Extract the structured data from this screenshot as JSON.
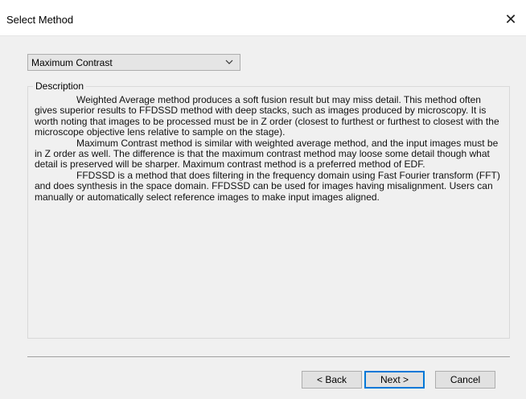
{
  "window": {
    "title": "Select Method",
    "close_glyph": "✕"
  },
  "method_select": {
    "selected": "Maximum Contrast"
  },
  "description": {
    "legend": "Description",
    "paragraphs": [
      "Weighted Average method produces a soft fusion result but may miss detail. This method often gives superior results to FFDSSD method with deep stacks, such as images produced by microscopy. It is worth noting that images to be processed must be in Z order (closest to furthest or furthest to closest with the microscope objective lens relative to sample on the stage).",
      "Maximum Contrast method is similar with weighted average method, and the input images must be in Z order as well. The difference is that the maximum contrast method may loose some detail though what detail is preserved will be sharper. Maximum contrast method is a preferred method of EDF.",
      "FFDSSD is a method that does filtering in the frequency domain using Fast Fourier transform (FFT) and does synthesis in the space domain. FFDSSD can be used for images having misalignment. Users can manually or automatically select reference images to make input images aligned."
    ]
  },
  "buttons": {
    "back": "< Back",
    "next": "Next >",
    "cancel": "Cancel"
  }
}
